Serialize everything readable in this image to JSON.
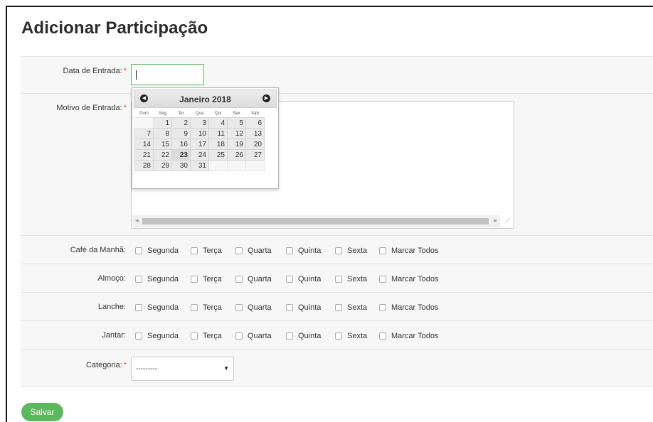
{
  "page": {
    "title": "Adicionar Participação"
  },
  "form": {
    "data_entrada": {
      "label": "Data de Entrada:",
      "required_mark": "*",
      "value": ""
    },
    "motivo_entrada": {
      "label": "Motivo de Entrada:",
      "required_mark": "*",
      "value": ""
    },
    "meals": [
      {
        "label": "Café da Manhã:",
        "days": [
          "Segunda",
          "Terça",
          "Quarta",
          "Quinta",
          "Sexta",
          "Marcar Todos"
        ]
      },
      {
        "label": "Almoço:",
        "days": [
          "Segunda",
          "Terça",
          "Quarta",
          "Quinta",
          "Sexta",
          "Marcar Todos"
        ]
      },
      {
        "label": "Lanche:",
        "days": [
          "Segunda",
          "Terça",
          "Quarta",
          "Quinta",
          "Sexta",
          "Marcar Todos"
        ]
      },
      {
        "label": "Jantar:",
        "days": [
          "Segunda",
          "Terça",
          "Quarta",
          "Quinta",
          "Sexta",
          "Marcar Todos"
        ]
      }
    ],
    "categoria": {
      "label": "Categoria:",
      "required_mark": "*",
      "selected": "---------"
    },
    "save_label": "Salvar"
  },
  "datepicker": {
    "month_title": "Janeiro 2018",
    "prev_icon": "chevron-left-icon",
    "next_icon": "chevron-right-icon",
    "weekdays": [
      "Dom",
      "Seg",
      "Ter",
      "Qua",
      "Qui",
      "Sex",
      "Sáb"
    ],
    "weeks": [
      [
        "",
        "1",
        "2",
        "3",
        "4",
        "5",
        "6"
      ],
      [
        "7",
        "8",
        "9",
        "10",
        "11",
        "12",
        "13"
      ],
      [
        "14",
        "15",
        "16",
        "17",
        "18",
        "19",
        "20"
      ],
      [
        "21",
        "22",
        "23",
        "24",
        "25",
        "26",
        "27"
      ],
      [
        "28",
        "29",
        "30",
        "31",
        "",
        "",
        ""
      ]
    ],
    "today": "23"
  }
}
